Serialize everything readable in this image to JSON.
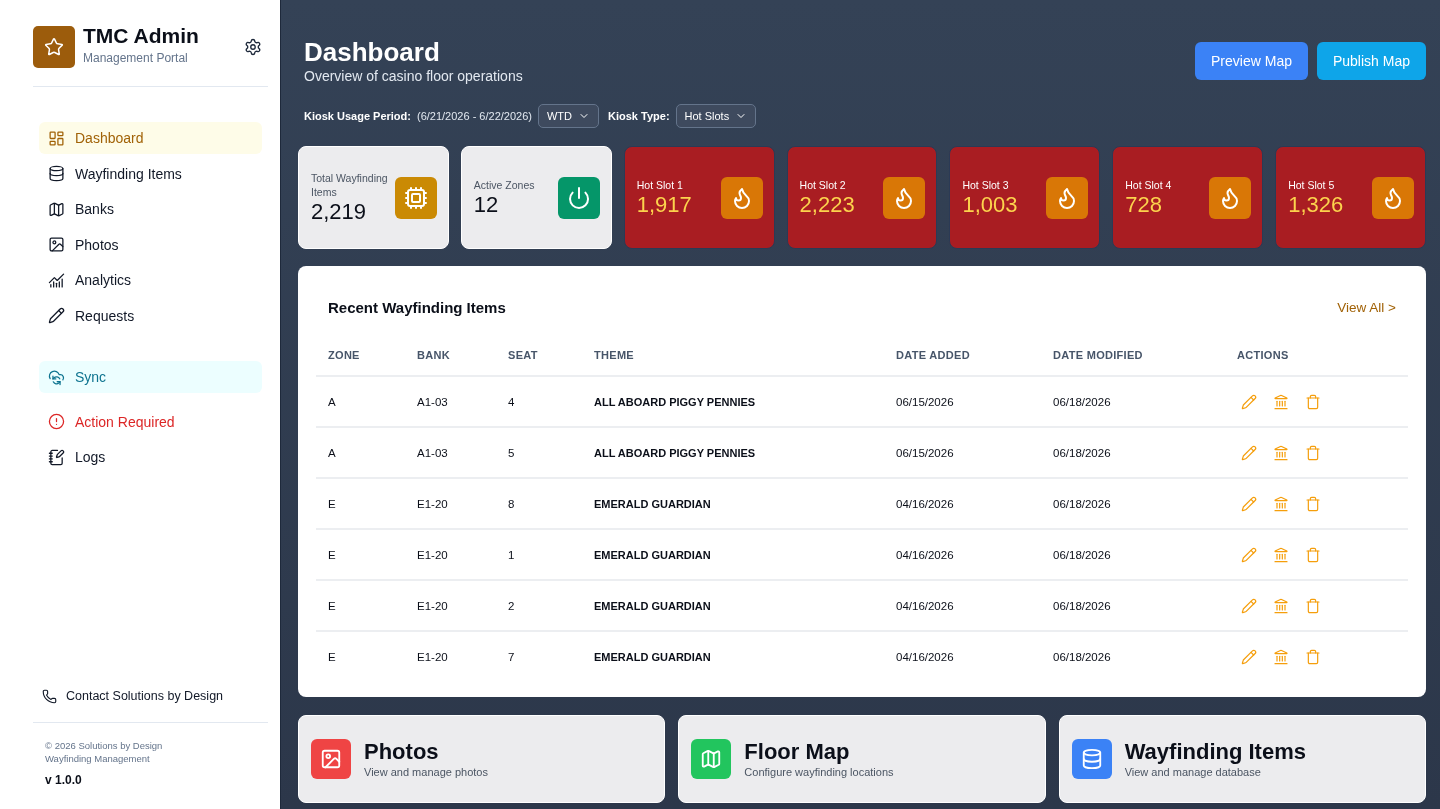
{
  "sidebar": {
    "brand": {
      "title": "TMC Admin",
      "subtitle": "Management Portal"
    },
    "nav": [
      {
        "label": "Dashboard",
        "selected": true
      },
      {
        "label": "Wayfinding Items",
        "selected": false
      },
      {
        "label": "Banks",
        "selected": false
      },
      {
        "label": "Photos",
        "selected": false
      },
      {
        "label": "Analytics",
        "selected": false
      },
      {
        "label": "Requests",
        "selected": false
      }
    ],
    "tools": [
      {
        "label": "Sync",
        "kind": "sync",
        "selected": false
      },
      {
        "label": "Action Required",
        "kind": "alert",
        "selected": false
      },
      {
        "label": "Logs",
        "kind": "plain",
        "selected": false
      }
    ],
    "contact": "Contact Solutions by Design",
    "copyright": "© 2026 Solutions by Design",
    "product": "Wayfinding Management",
    "version": "v 1.0.0"
  },
  "header": {
    "title": "Dashboard",
    "subtitle": "Overview of casino floor operations",
    "buttons": [
      {
        "label": "Preview Map",
        "kind": "preview"
      },
      {
        "label": "Publish Map",
        "kind": "publish"
      }
    ]
  },
  "filters": [
    {
      "label": "Kiosk Usage Period:",
      "note": "(6/21/2026 - 6/22/2026)",
      "value": "WTD"
    },
    {
      "label": "Kiosk Type:",
      "value": "Hot Slots"
    }
  ],
  "stats": [
    {
      "kind": "items",
      "label": "Total Wayfinding Items",
      "value": "2,219"
    },
    {
      "kind": "zones",
      "label": "Active Zones",
      "value": "12"
    },
    {
      "kind": "hot",
      "label": "Hot Slot 1",
      "value": "1,917"
    },
    {
      "kind": "hot",
      "label": "Hot Slot 2",
      "value": "2,223"
    },
    {
      "kind": "hot",
      "label": "Hot Slot 3",
      "value": "1,003"
    },
    {
      "kind": "hot",
      "label": "Hot Slot 4",
      "value": "728"
    },
    {
      "kind": "hot",
      "label": "Hot Slot 5",
      "value": "1,326"
    }
  ],
  "recent": {
    "title": "Recent Wayfinding Items",
    "link": "View All >",
    "columns": [
      {
        "label": "ZONE",
        "kind": "text"
      },
      {
        "label": "BANK",
        "kind": "text"
      },
      {
        "label": "SEAT",
        "kind": "text"
      },
      {
        "label": "THEME",
        "kind": "strong"
      },
      {
        "label": "DATE ADDED",
        "kind": "text"
      },
      {
        "label": "DATE MODIFIED",
        "kind": "text"
      },
      {
        "label": "ACTIONS",
        "kind": "actions"
      }
    ],
    "rows": [
      {
        "cells": [
          "A",
          "A1-03",
          "4",
          "ALL ABOARD PIGGY PENNIES",
          "06/15/2026",
          "06/18/2026"
        ]
      },
      {
        "cells": [
          "A",
          "A1-03",
          "5",
          "ALL ABOARD PIGGY PENNIES",
          "06/15/2026",
          "06/18/2026"
        ]
      },
      {
        "cells": [
          "E",
          "E1-20",
          "8",
          "EMERALD GUARDIAN",
          "04/16/2026",
          "06/18/2026"
        ]
      },
      {
        "cells": [
          "E",
          "E1-20",
          "1",
          "EMERALD GUARDIAN",
          "04/16/2026",
          "06/18/2026"
        ]
      },
      {
        "cells": [
          "E",
          "E1-20",
          "2",
          "EMERALD GUARDIAN",
          "04/16/2026",
          "06/18/2026"
        ]
      },
      {
        "cells": [
          "E",
          "E1-20",
          "7",
          "EMERALD GUARDIAN",
          "04/16/2026",
          "06/18/2026"
        ]
      }
    ]
  },
  "shortcuts": [
    {
      "kind": "photos",
      "title": "Photos",
      "subtitle": "View and manage photos"
    },
    {
      "kind": "map",
      "title": "Floor Map",
      "subtitle": "Configure wayfinding locations"
    },
    {
      "kind": "database",
      "title": "Wayfinding Items",
      "subtitle": "View and manage database"
    }
  ]
}
